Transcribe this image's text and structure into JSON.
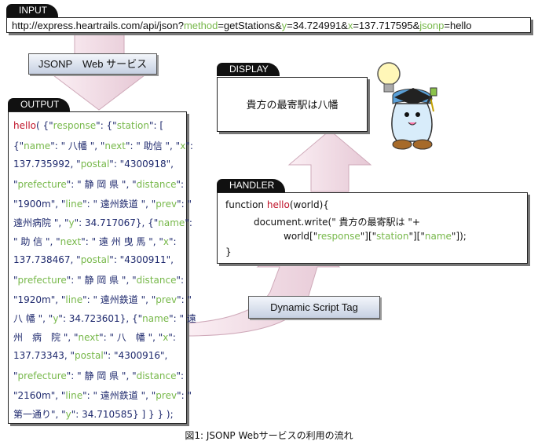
{
  "input": {
    "tab": "INPUT",
    "parts": [
      {
        "t": "http://express.heartrails.com/api/json?",
        "c": ""
      },
      {
        "t": "method",
        "c": "g"
      },
      {
        "t": "=getStations&",
        "c": ""
      },
      {
        "t": "y",
        "c": "g"
      },
      {
        "t": "=34.724991&",
        "c": ""
      },
      {
        "t": "x",
        "c": "g"
      },
      {
        "t": "=137.717595&",
        "c": ""
      },
      {
        "t": "jsonp",
        "c": "g"
      },
      {
        "t": "=hello",
        "c": ""
      }
    ]
  },
  "jsonp_label": "JSONP　Web サービス",
  "output": {
    "tab": "OUTPUT",
    "lines": [
      [
        {
          "t": "hello",
          "c": "r"
        },
        {
          "t": "( {\"",
          "c": ""
        },
        {
          "t": "response",
          "c": "g"
        },
        {
          "t": "\": {\"",
          "c": ""
        },
        {
          "t": "station",
          "c": "g"
        },
        {
          "t": "\": [",
          "c": ""
        }
      ],
      [
        {
          "t": "{\"",
          "c": ""
        },
        {
          "t": "name",
          "c": "g"
        },
        {
          "t": "\": \" 八幡 \", \"",
          "c": ""
        },
        {
          "t": "next",
          "c": "g"
        },
        {
          "t": "\": \" 助信 \", \"",
          "c": ""
        },
        {
          "t": "x",
          "c": "g"
        },
        {
          "t": "\":",
          "c": ""
        }
      ],
      [
        {
          "t": "137.735992, \"",
          "c": ""
        },
        {
          "t": "postal",
          "c": "g"
        },
        {
          "t": "\": \"4300918\",",
          "c": ""
        }
      ],
      [
        {
          "t": "\"",
          "c": ""
        },
        {
          "t": "prefecture",
          "c": "g"
        },
        {
          "t": "\": \" 静 岡 県 \", \"",
          "c": ""
        },
        {
          "t": "distance",
          "c": "g"
        },
        {
          "t": "\":",
          "c": ""
        }
      ],
      [
        {
          "t": "\"1900m\", \"",
          "c": ""
        },
        {
          "t": "line",
          "c": "g"
        },
        {
          "t": "\": \" 遠州鉄道 \", \"",
          "c": ""
        },
        {
          "t": "prev",
          "c": "g"
        },
        {
          "t": "\": \"",
          "c": ""
        }
      ],
      [
        {
          "t": "遠州病院 \", \"",
          "c": ""
        },
        {
          "t": "y",
          "c": "g"
        },
        {
          "t": "\": 34.717067}, {\"",
          "c": ""
        },
        {
          "t": "name",
          "c": "g"
        },
        {
          "t": "\":",
          "c": ""
        }
      ],
      [
        {
          "t": "\" 助 信 \", \"",
          "c": ""
        },
        {
          "t": "next",
          "c": "g"
        },
        {
          "t": "\": \" 遠 州 曳 馬 \", \"",
          "c": ""
        },
        {
          "t": "x",
          "c": "g"
        },
        {
          "t": "\":",
          "c": ""
        }
      ],
      [
        {
          "t": "137.738467, \"",
          "c": ""
        },
        {
          "t": "postal",
          "c": "g"
        },
        {
          "t": "\": \"4300911\",",
          "c": ""
        }
      ],
      [
        {
          "t": "\"",
          "c": ""
        },
        {
          "t": "prefecture",
          "c": "g"
        },
        {
          "t": "\": \" 静 岡 県 \", \"",
          "c": ""
        },
        {
          "t": "distance",
          "c": "g"
        },
        {
          "t": "\":",
          "c": ""
        }
      ],
      [
        {
          "t": "\"1920m\", \"",
          "c": ""
        },
        {
          "t": "line",
          "c": "g"
        },
        {
          "t": "\": \" 遠州鉄道 \", \"",
          "c": ""
        },
        {
          "t": "prev",
          "c": "g"
        },
        {
          "t": "\": \"",
          "c": ""
        }
      ],
      [
        {
          "t": "八 幡 \", \"",
          "c": ""
        },
        {
          "t": "y",
          "c": "g"
        },
        {
          "t": "\": 34.723601}, {\"",
          "c": ""
        },
        {
          "t": "name",
          "c": "g"
        },
        {
          "t": "\": \" 遠",
          "c": ""
        }
      ],
      [
        {
          "t": "州　病　院 \", \"",
          "c": ""
        },
        {
          "t": "next",
          "c": "g"
        },
        {
          "t": "\": \" 八　幡 \", \"",
          "c": ""
        },
        {
          "t": "x",
          "c": "g"
        },
        {
          "t": "\":",
          "c": ""
        }
      ],
      [
        {
          "t": "137.73343, \"",
          "c": ""
        },
        {
          "t": "postal",
          "c": "g"
        },
        {
          "t": "\": \"4300916\",",
          "c": ""
        }
      ],
      [
        {
          "t": "\"",
          "c": ""
        },
        {
          "t": "prefecture",
          "c": "g"
        },
        {
          "t": "\": \" 静 岡 県 \", \"",
          "c": ""
        },
        {
          "t": "distance",
          "c": "g"
        },
        {
          "t": "\":",
          "c": ""
        }
      ],
      [
        {
          "t": "\"2160m\", \"",
          "c": ""
        },
        {
          "t": "line",
          "c": "g"
        },
        {
          "t": "\": \" 遠州鉄道 \", \"",
          "c": ""
        },
        {
          "t": "prev",
          "c": "g"
        },
        {
          "t": "\": \"",
          "c": ""
        }
      ],
      [
        {
          "t": "第一通り\", \"",
          "c": ""
        },
        {
          "t": "y",
          "c": "g"
        },
        {
          "t": "\": 34.710585} ] } } );",
          "c": ""
        }
      ]
    ]
  },
  "dst_label": "Dynamic Script Tag",
  "handler": {
    "tab": "HANDLER",
    "lines": [
      [
        {
          "t": "function ",
          "c": ""
        },
        {
          "t": "hello",
          "c": "r"
        },
        {
          "t": "(world){",
          "c": ""
        }
      ],
      [
        {
          "t": "document.write(\" 貴方の最寄駅は \"+",
          "c": ""
        }
      ],
      [
        {
          "t": "world[\"",
          "c": ""
        },
        {
          "t": "response",
          "c": "g"
        },
        {
          "t": "\"][\"",
          "c": ""
        },
        {
          "t": "station",
          "c": "g"
        },
        {
          "t": "\"][\"",
          "c": ""
        },
        {
          "t": "name",
          "c": "g"
        },
        {
          "t": "\"]);",
          "c": ""
        }
      ],
      [
        {
          "t": "}",
          "c": ""
        }
      ]
    ]
  },
  "display": {
    "tab": "DISPLAY",
    "text": "貴方の最寄駅は八幡"
  },
  "caption": "図1: JSONP Webサービスの利用の流れ",
  "colors": {
    "key": "#77b84a",
    "fn": "#c0142a",
    "arrow": "#f1dce6"
  },
  "icons": [
    "lightbulb-icon",
    "mascot-icon"
  ]
}
